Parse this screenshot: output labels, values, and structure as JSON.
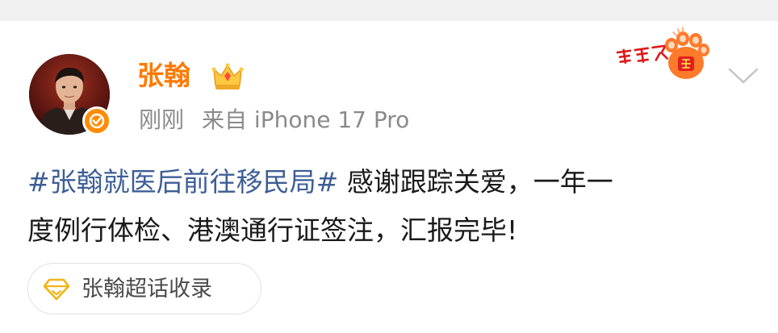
{
  "post": {
    "username": "张翰",
    "timestamp": "刚刚",
    "source": "来自 iPhone 17 Pro",
    "hashtag": "#张翰就医后前往移民局#",
    "body_line1": " 感谢跟踪关爱，一年一",
    "body_line2": "度例行体检、港澳通行证签注，汇报完毕!",
    "supertopic_label": "张翰超话收录"
  },
  "colors": {
    "username": "#ff7a00",
    "hashtag": "#3d5e96",
    "verified_badge": "#ff8c00",
    "meta_text": "#8a8a8a"
  },
  "icons": {
    "verified": "verified-badge-icon",
    "crown": "crown-icon",
    "sticker": "tiger-paw-sticker",
    "chevron": "chevron-down-icon",
    "supertopic": "diamond-icon"
  }
}
